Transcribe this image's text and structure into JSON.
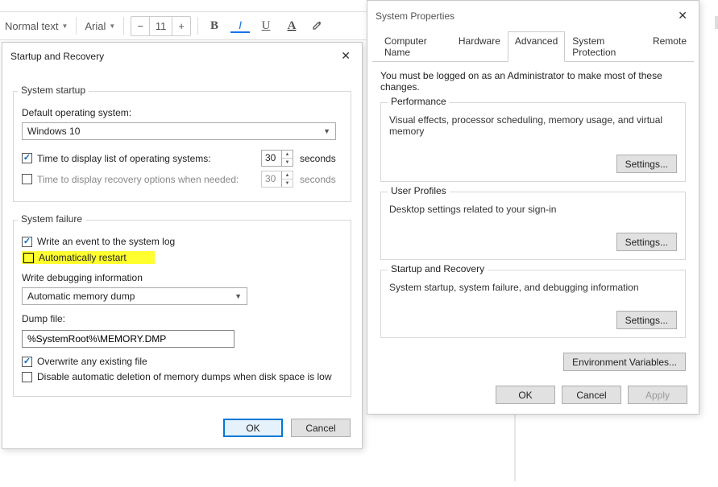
{
  "wp": {
    "style": "Normal text",
    "font": "Arial",
    "size": "11",
    "minus": "−",
    "plus": "+",
    "bold": "B",
    "italic": "I",
    "underline": "U",
    "textcolor": "A"
  },
  "sr": {
    "title": "Startup and Recovery",
    "grp_startup": "System startup",
    "default_os_label": "Default operating system:",
    "default_os_value": "Windows 10",
    "chk_time_os": "Time to display list of operating systems:",
    "time_os_value": "30",
    "seconds": "seconds",
    "chk_time_recovery": "Time to display recovery options when needed:",
    "time_recovery_value": "30",
    "grp_failure": "System failure",
    "chk_log": "Write an event to the system log",
    "chk_auto_restart": "Automatically restart",
    "dbg_label": "Write debugging information",
    "dbg_value": "Automatic memory dump",
    "dumpfile_label": "Dump file:",
    "dumpfile_value": "%SystemRoot%\\MEMORY.DMP",
    "chk_overwrite": "Overwrite any existing file",
    "chk_disable_delete": "Disable automatic deletion of memory dumps when disk space is low",
    "ok": "OK",
    "cancel": "Cancel"
  },
  "sp": {
    "title": "System Properties",
    "tabs": {
      "computer_name": "Computer Name",
      "hardware": "Hardware",
      "advanced": "Advanced",
      "protection": "System Protection",
      "remote": "Remote"
    },
    "intro": "You must be logged on as an Administrator to make most of these changes.",
    "perf": {
      "legend": "Performance",
      "desc": "Visual effects, processor scheduling, memory usage, and virtual memory"
    },
    "profiles": {
      "legend": "User Profiles",
      "desc": "Desktop settings related to your sign-in"
    },
    "startup": {
      "legend": "Startup and Recovery",
      "desc": "System startup, system failure, and debugging information"
    },
    "settings_btn": "Settings...",
    "env_btn": "Environment Variables...",
    "ok": "OK",
    "cancel": "Cancel",
    "apply": "Apply"
  }
}
